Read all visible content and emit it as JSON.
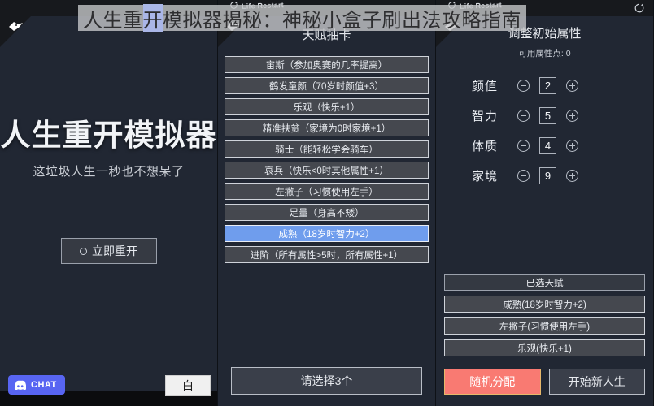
{
  "overlay": {
    "title_before": "人生重",
    "title_selected": "开",
    "title_after": "模拟器揭秘：神秘小盒子刷出法攻略指南"
  },
  "branding": {
    "label": "Life Restart",
    "refresh_icon": "refresh-icon",
    "corner_icon": "bird-logo-icon"
  },
  "left_panel": {
    "title": "人生重开模拟器",
    "subtitle": "这垃圾人生一秒也不想呆了",
    "restart_button": "立即重开",
    "restart_icon": "circle-icon",
    "chat_label": "CHAT",
    "chat_icon": "discord-icon",
    "white_button": "白"
  },
  "middle_panel": {
    "header": "天赋抽卡",
    "cards": [
      {
        "label": "宙斯（参加奥赛的几率提高）",
        "selected": false
      },
      {
        "label": "鹤发童颜（70岁时颜值+3）",
        "selected": false
      },
      {
        "label": "乐观（快乐+1）",
        "selected": false
      },
      {
        "label": "精准扶贫（家境为0时家境+1）",
        "selected": false
      },
      {
        "label": "骑士（能轻松学会骑车）",
        "selected": false
      },
      {
        "label": "哀兵（快乐<0时其他属性+1）",
        "selected": false
      },
      {
        "label": "左撇子（习惯使用左手）",
        "selected": false
      },
      {
        "label": "足量（身高不矮）",
        "selected": false
      },
      {
        "label": "成熟（18岁时智力+2）",
        "selected": true
      },
      {
        "label": "进阶（所有属性>5时，所有属性+1）",
        "selected": false
      }
    ],
    "footer_button": "请选择3个"
  },
  "right_panel": {
    "header": "调整初始属性",
    "points_label": "可用属性点: 0",
    "attributes": [
      {
        "name": "颜值",
        "value": "2"
      },
      {
        "name": "智力",
        "value": "5"
      },
      {
        "name": "体质",
        "value": "4"
      },
      {
        "name": "家境",
        "value": "9"
      }
    ],
    "selected_header": "已选天赋",
    "selected_talents": [
      "成熟(18岁时智力+2)",
      "左撇子(习惯使用左手)",
      "乐观(快乐+1)"
    ],
    "random_button": "随机分配",
    "start_button": "开始新人生"
  },
  "colors": {
    "background": "#212733",
    "card": "#45484f",
    "card_selected": "#6f9ded",
    "accent_red": "#f97a72",
    "discord": "#5865f2"
  }
}
